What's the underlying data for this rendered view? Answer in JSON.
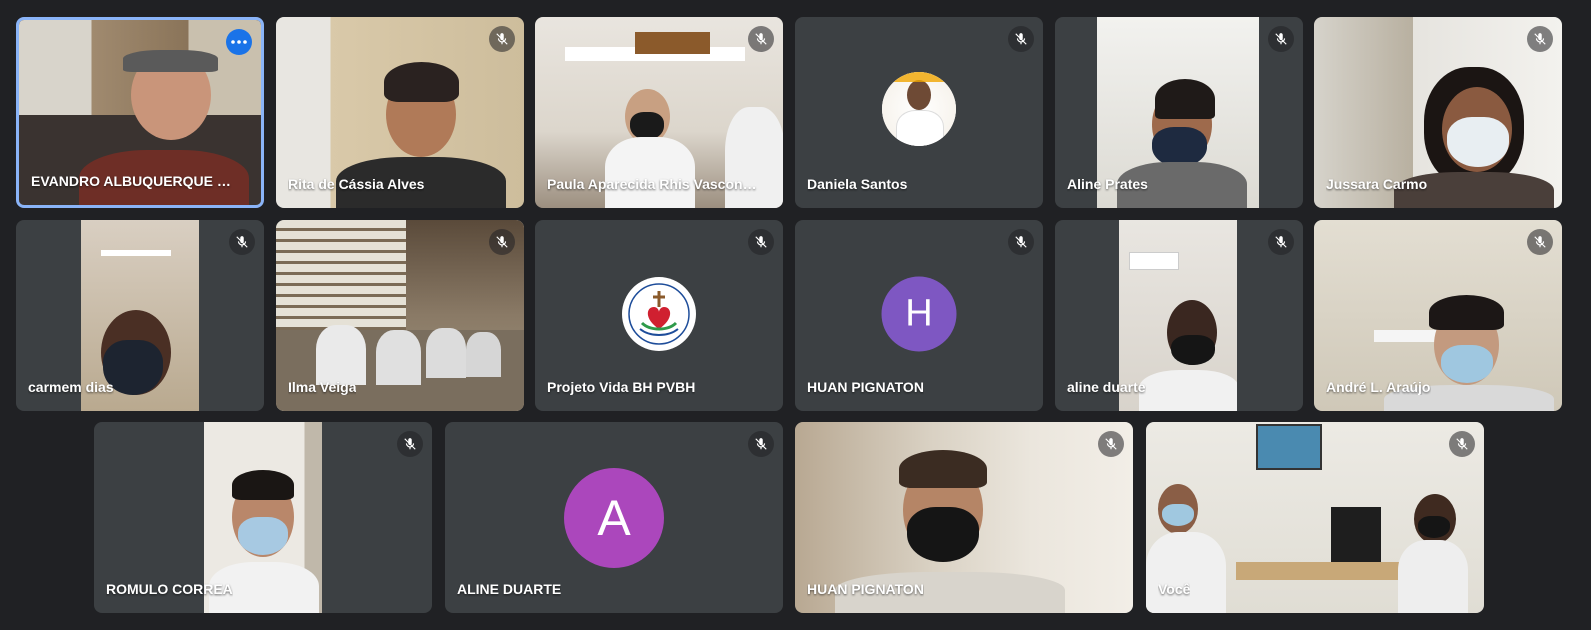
{
  "participants": [
    {
      "name": "EVANDRO ALBUQUERQUE DE ...",
      "muted": false,
      "active": true
    },
    {
      "name": "Rita de Cássia Alves",
      "muted": true
    },
    {
      "name": "Paula Aparecida Rhis Vasconce...",
      "muted": true
    },
    {
      "name": "Daniela Santos",
      "muted": true
    },
    {
      "name": "Aline Prates",
      "muted": true
    },
    {
      "name": "Jussara Carmo",
      "muted": true
    },
    {
      "name": "carmem dias",
      "muted": true
    },
    {
      "name": "Ilma Veiga",
      "muted": true
    },
    {
      "name": "Projeto Vida BH PVBH",
      "muted": true
    },
    {
      "name": "HUAN PIGNATON",
      "muted": true,
      "avatar_letter": "H",
      "avatar_color": "#7e57c2"
    },
    {
      "name": "aline duarte",
      "muted": true
    },
    {
      "name": "André L. Araújo",
      "muted": true
    },
    {
      "name": "ROMULO CORREA",
      "muted": true
    },
    {
      "name": "ALINE DUARTE",
      "muted": true,
      "avatar_letter": "A",
      "avatar_color": "#ab47bc"
    },
    {
      "name": "HUAN PIGNATON",
      "muted": true
    },
    {
      "name": "Você",
      "muted": true
    }
  ],
  "icons": {
    "mic_off": "mic-off-icon",
    "more": "more-options-icon"
  },
  "colors": {
    "background": "#202124",
    "tile": "#3c4043",
    "active_border": "#8ab4f8",
    "more_button": "#1a73e8"
  }
}
